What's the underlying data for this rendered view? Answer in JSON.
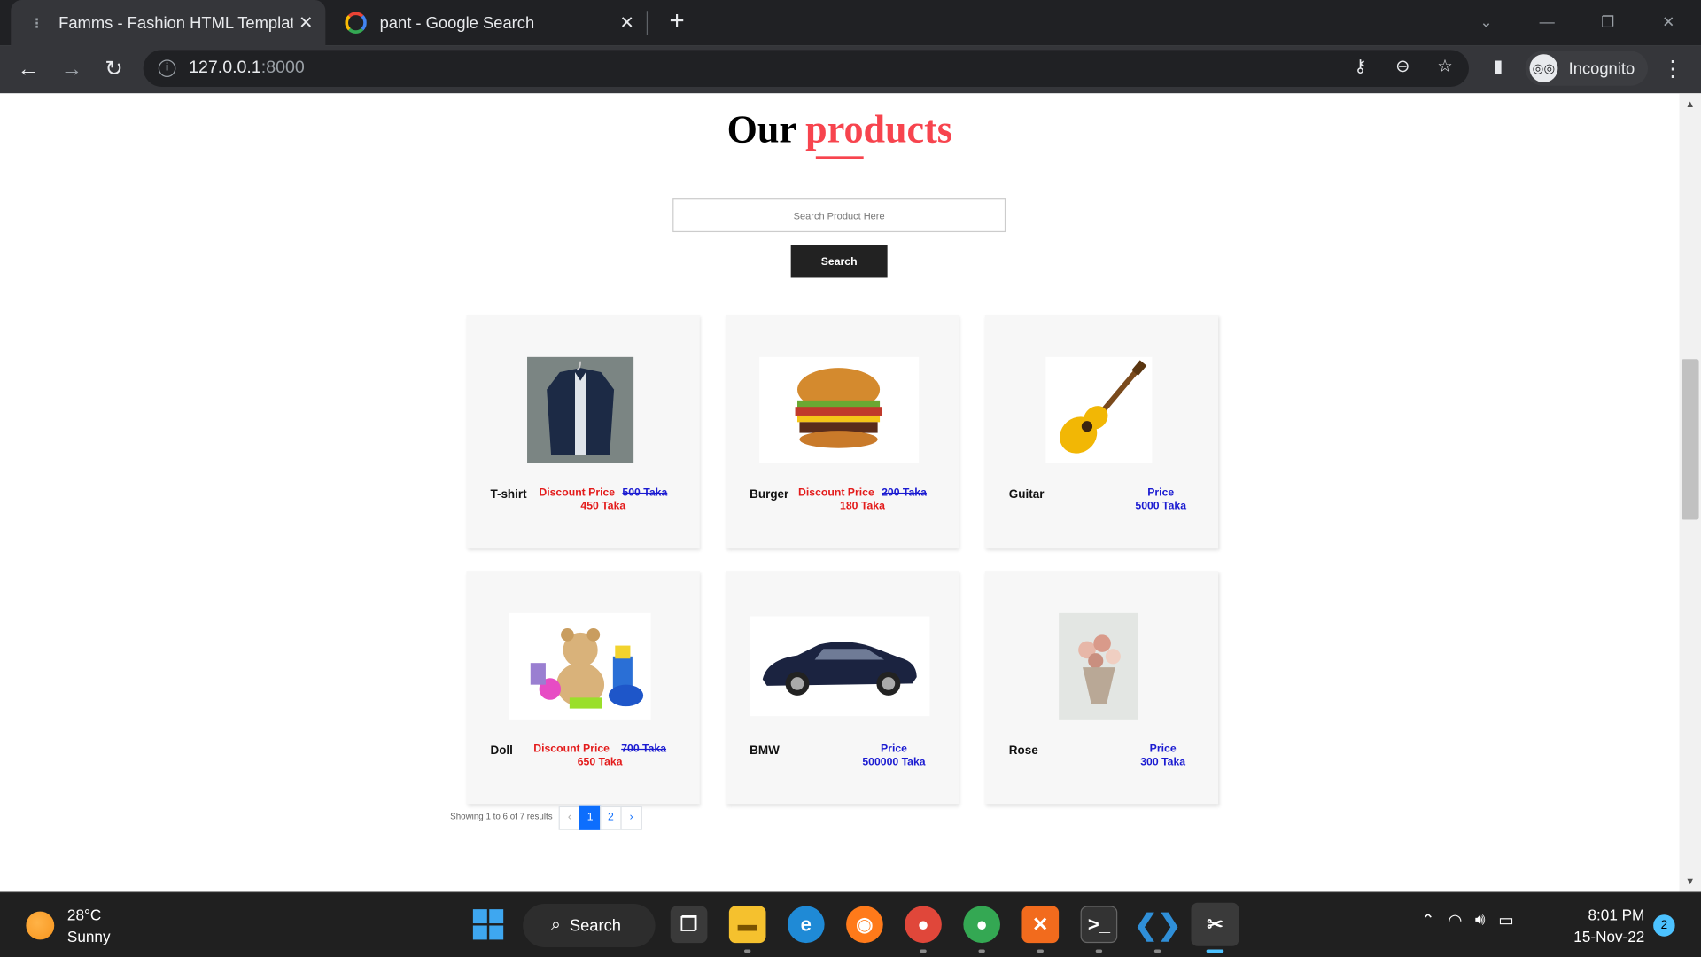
{
  "browser": {
    "tabs": [
      {
        "title": "Famms - Fashion HTML Template",
        "icon": "page-favicon"
      },
      {
        "title": "pant - Google Search",
        "icon": "google-favicon"
      }
    ],
    "url_host": "127.0.0.1",
    "url_port": ":8000",
    "incognito_label": "Incognito"
  },
  "page": {
    "heading_main": "Our ",
    "heading_accent": "products",
    "accent_color": "#f7444e",
    "search_placeholder": "Search Product Here",
    "search_button": "Search",
    "products": [
      {
        "name": "T-shirt",
        "price_label": "Discount Price",
        "old_price": "500 Taka",
        "price": "450 Taka",
        "discount": true
      },
      {
        "name": "Burger",
        "price_label": "Discount Price",
        "old_price": "200 Taka",
        "price": "180 Taka",
        "discount": true
      },
      {
        "name": "Guitar",
        "price_label": "Price",
        "price": "5000 Taka",
        "discount": false
      },
      {
        "name": "Doll",
        "price_label": "Discount Price",
        "old_price": "700 Taka",
        "price": "650 Taka",
        "discount": true
      },
      {
        "name": "BMW",
        "price_label": "Price",
        "price": "500000 Taka",
        "discount": false
      },
      {
        "name": "Rose",
        "price_label": "Price",
        "price": "300 Taka",
        "discount": false
      }
    ],
    "pagination": {
      "summary": "Showing 1 to 6 of 7 results",
      "prev": "‹",
      "pages": [
        "1",
        "2"
      ],
      "next": "›",
      "active_page": "1"
    }
  },
  "taskbar": {
    "weather_temp": "28°C",
    "weather_desc": "Sunny",
    "search_label": "Search",
    "time": "8:01 PM",
    "date": "15-Nov-22",
    "notification_count": "2"
  }
}
